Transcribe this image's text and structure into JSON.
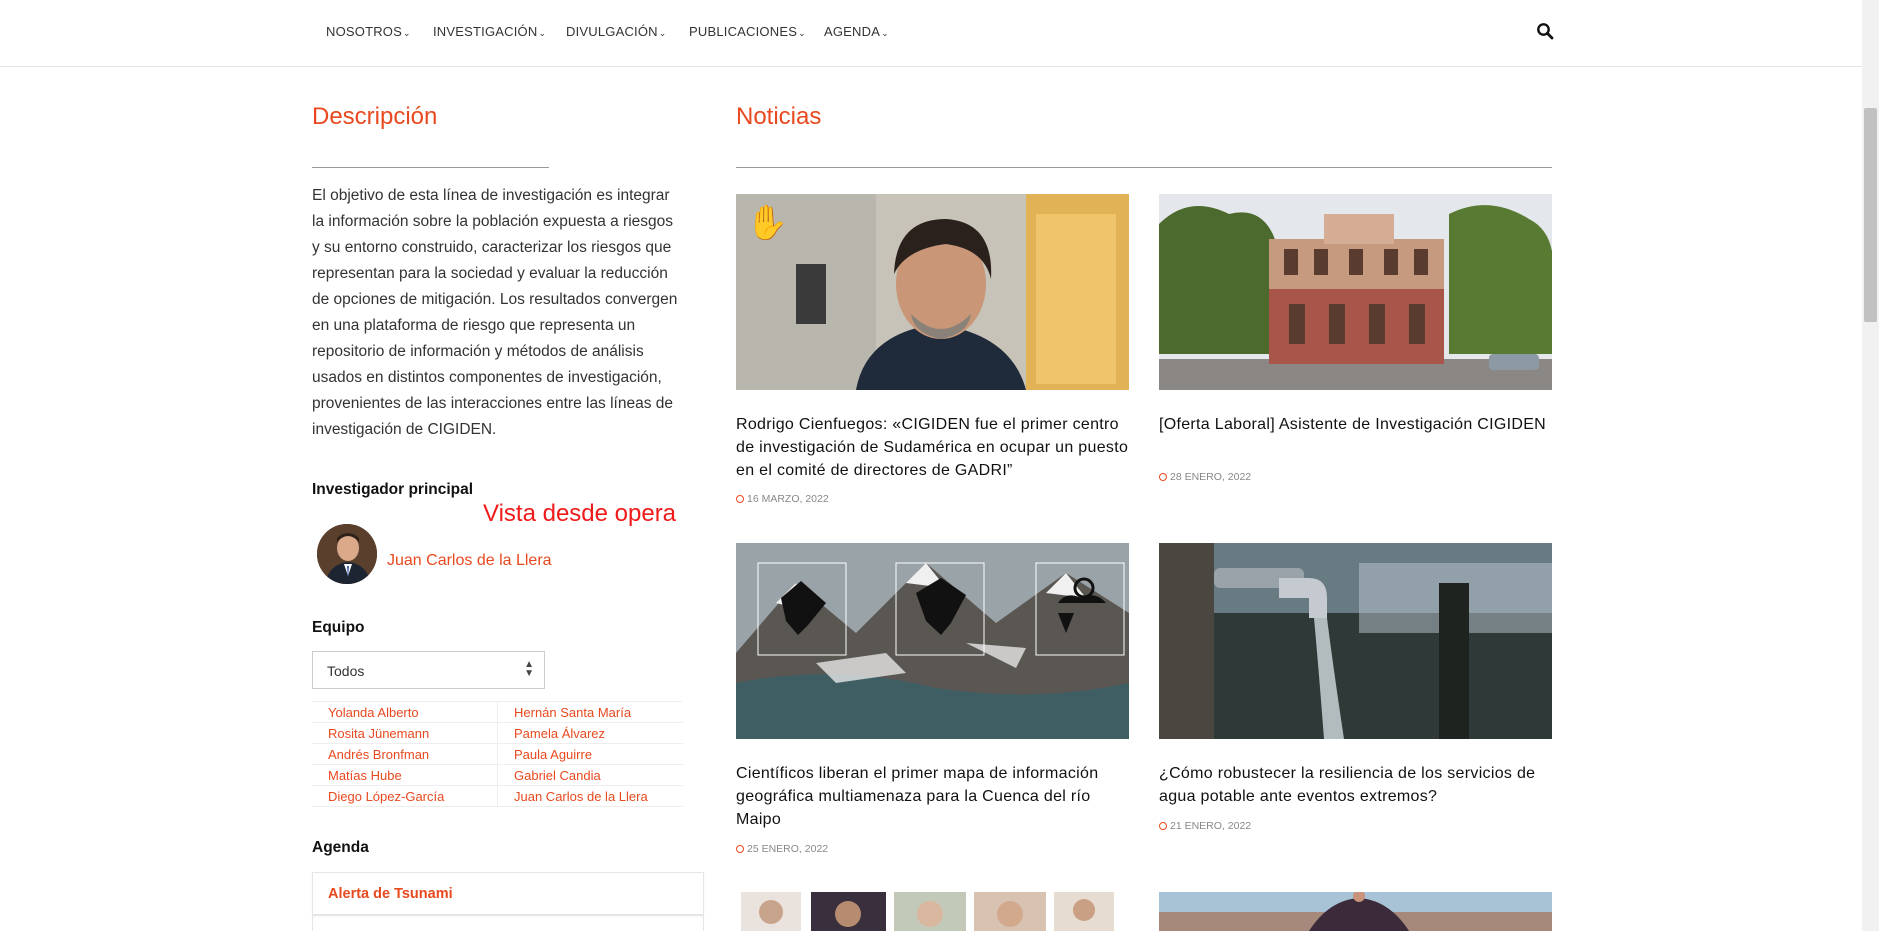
{
  "nav": {
    "items": [
      {
        "label": "NOSOTROS"
      },
      {
        "label": "INVESTIGACIÓN"
      },
      {
        "label": "DIVULGACIÓN"
      },
      {
        "label": "PUBLICACIONES"
      },
      {
        "label": "AGENDA"
      }
    ],
    "caret": "⌄",
    "search_icon": "search-icon"
  },
  "descripcion": {
    "title": "Descripción",
    "text": "El objetivo de esta línea de investigación es integrar la información sobre la población expuesta a riesgos y su entorno construido, caracterizar los riesgos que representan para la sociedad y evaluar la reducción de opciones de mitigación. Los resultados convergen en una plataforma de riesgo que representa un repositorio de información y métodos de análisis usados en distintos componentes de investigación, provenientes de las interacciones entre las líneas de investigación de CIGIDEN."
  },
  "investigador": {
    "heading": "Investigador principal",
    "name": "Juan Carlos de la Llera"
  },
  "overlay_note": "Vista desde opera",
  "equipo": {
    "heading": "Equipo",
    "select_value": "Todos",
    "left": [
      "Yolanda Alberto",
      "Rosita Jünemann",
      "Andrés Bronfman",
      "Matías Hube",
      "Diego López-García"
    ],
    "right": [
      "Hernán Santa María",
      "Pamela Álvarez",
      "Paula Aguirre",
      "Gabriel Candia",
      "Juan Carlos de la Llera"
    ]
  },
  "agenda": {
    "heading": "Agenda",
    "items": [
      {
        "title": "Alerta de Tsunami"
      }
    ]
  },
  "noticias": {
    "title": "Noticias",
    "items": [
      {
        "title": "Rodrigo Cienfuegos: «CIGIDEN fue el primer centro de investigación de Sudamérica en ocupar un puesto en el comité de directores de GADRI”",
        "date": "16 MARZO, 2022"
      },
      {
        "title": "[Oferta Laboral] Asistente de Investigación CIGIDEN",
        "date": "28 ENERO, 2022"
      },
      {
        "title": "Científicos liberan el primer mapa de información geográfica multiamenaza para la Cuenca del río Maipo",
        "date": "25 ENERO, 2022"
      },
      {
        "title": "¿Cómo robustecer la resiliencia de los servicios de agua potable ante eventos extremos?",
        "date": "21 ENERO, 2022"
      }
    ]
  },
  "colors": {
    "accent": "#e8491e",
    "overlay_red": "#ef1b1b"
  }
}
